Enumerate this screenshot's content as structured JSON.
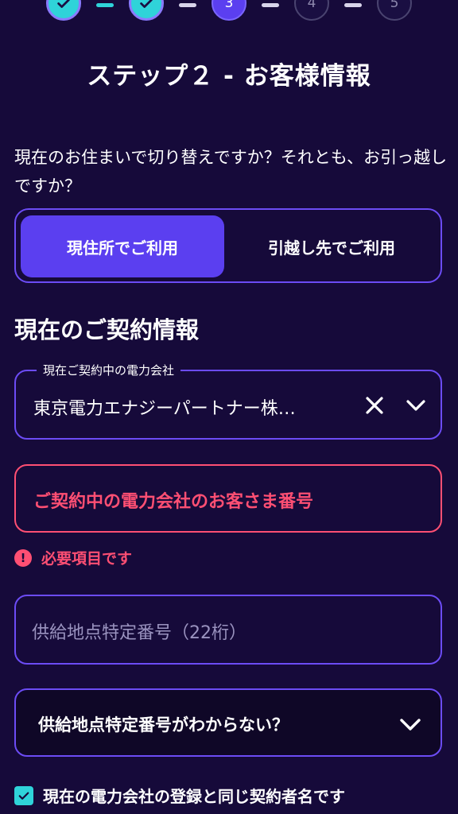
{
  "stepper": {
    "steps": [
      {
        "label": "",
        "state": "done"
      },
      {
        "label": "",
        "state": "done"
      },
      {
        "label": "3",
        "state": "current"
      },
      {
        "label": "4",
        "state": "todo"
      },
      {
        "label": "5",
        "state": "todo"
      }
    ]
  },
  "title": "ステップ２ - お客様情報",
  "question": "現在のお住まいで切り替えですか？それとも、お引っ越しですか？",
  "move_toggle": {
    "options": [
      "現住所でご利用",
      "引越し先でご利用"
    ],
    "selected": "現住所でご利用"
  },
  "section_title": "現在のご契約情報",
  "company_field": {
    "label": "現在ご契約中の電力会社",
    "value": "東京電力エナジーパートナー株…",
    "clear_icon": "close-icon",
    "dropdown_icon": "chevron-down-icon"
  },
  "customer_number_field": {
    "placeholder": "ご契約中の電力会社のお客さま番号",
    "error": "必要項目です",
    "error_icon": "alert-icon"
  },
  "supply_point_field": {
    "placeholder": "供給地点特定番号（22桁）"
  },
  "supply_help": {
    "label": "供給地点特定番号がわからない？",
    "icon": "chevron-down-icon"
  },
  "same_name_checkbox": {
    "label": "現在の電力会社の登録と同じ契約者名です",
    "checked": true
  },
  "colors": {
    "background": "#160a3a",
    "accent": "#5b3ff0",
    "border": "#6c4cf5",
    "teal": "#2fd3d9",
    "error": "#ff4f73"
  }
}
